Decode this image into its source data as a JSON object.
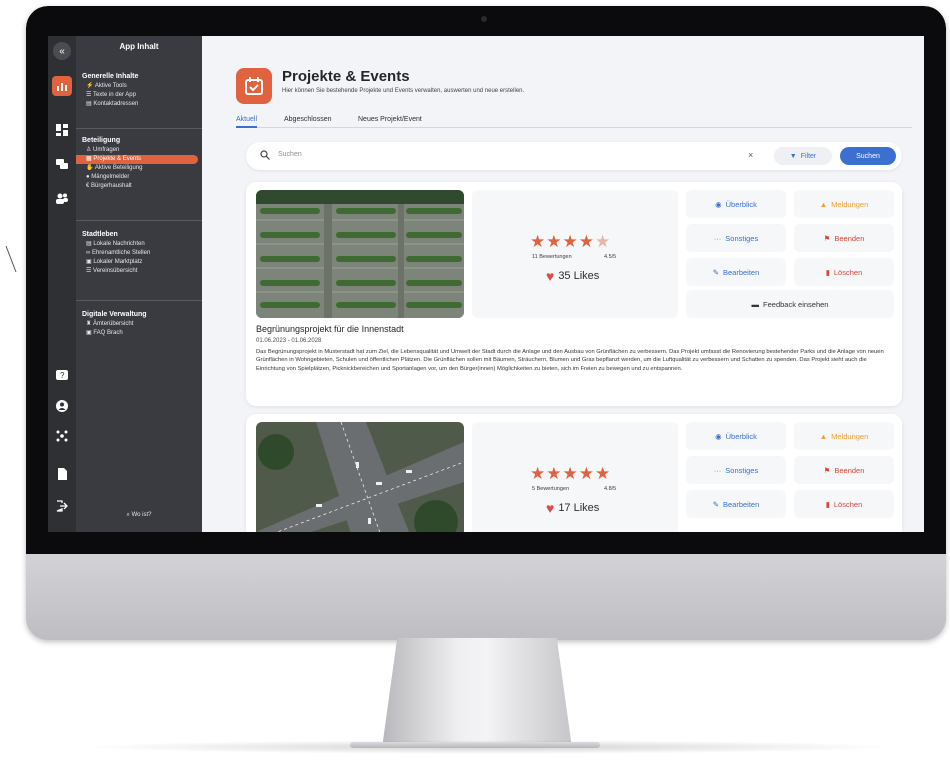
{
  "app": {
    "sidebar_title": "App Inhalt",
    "footer": "Wo ist?"
  },
  "sidebar": {
    "sections": [
      {
        "title": "Generelle Inhalte",
        "items": [
          "Aktive Tools",
          "Texte in der App",
          "Kontaktadressen"
        ]
      },
      {
        "title": "Beteiligung",
        "items": [
          "Umfragen",
          "Projekte & Events",
          "Aktive Beteiligung",
          "Mängelmelder",
          "Bürgerhaushalt"
        ]
      },
      {
        "title": "Stadtleben",
        "items": [
          "Lokale Nachrichten",
          "Ehrenamtliche Stellen",
          "Lokaler Marktplatz",
          "Vereinsübersicht"
        ]
      },
      {
        "title": "Digitale Verwaltung",
        "items": [
          "Ämterübersicht",
          "FAQ Brach"
        ]
      }
    ],
    "selected": "Projekte & Events"
  },
  "page": {
    "title": "Projekte & Events",
    "subtitle": "Hier können Sie bestehende Projekte und Events verwalten, auswerten und neue erstellen.",
    "tabs": [
      "Aktuell",
      "Abgeschlossen",
      "Neues Projekt/Event"
    ],
    "active_tab": "Aktuell"
  },
  "search": {
    "placeholder": "Suchen",
    "filter_label": "Filter",
    "button_label": "Suchen"
  },
  "actions": {
    "overview": "Überblick",
    "reports": "Meldungen",
    "misc": "Sonstiges",
    "end": "Beenden",
    "edit": "Bearbeiten",
    "delete": "Löschen",
    "feedback": "Feedback einsehen"
  },
  "projects": [
    {
      "rating_count": "11 Bewertungen",
      "rating_value": "4.5/5",
      "rating": 4.5,
      "likes": "35 Likes",
      "title": "Begrünungsprojekt für die Innenstadt",
      "dates": "01.06.2023 - 01.06.2028",
      "description": "Das Begrünungsprojekt in Musterstadt hat zum Ziel, die Lebensqualität und Umwelt der Stadt durch die Anlage und den Ausbau von Grünflächen zu verbessern. Das Projekt umfasst die Renovierung bestehender Parks und die Anlage von neuen Grünflächen in Wohngebieten, Schulen und öffentlichen Plätzen. Die Grünflächen sollen mit Bäumen, Sträuchern, Blumen und Gras bepflanzt werden, um die Luftqualität zu verbessern und Schatten zu spenden. Das Projekt sieht auch die Einrichtung von Spielplätzen, Picknickbereichen und Sportanlagen vor, um den Bürger(innen) Möglichkeiten zu bieten, sich im Freien zu bewegen und zu entspannen."
    },
    {
      "rating_count": "5 Bewertungen",
      "rating_value": "4.8/5",
      "rating": 4.8,
      "likes": "17 Likes"
    }
  ],
  "colors": {
    "accent": "#e0623f",
    "primary": "#3b6fd0",
    "sidebar": "#3a3b40",
    "rail": "#2f3034"
  }
}
